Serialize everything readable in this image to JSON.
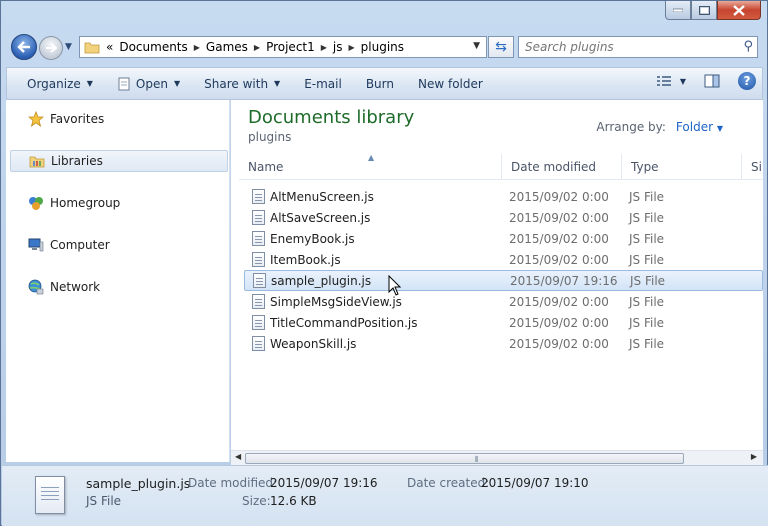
{
  "address": {
    "overflow_marker": "«",
    "crumbs": [
      "Documents",
      "Games",
      "Project1",
      "js",
      "plugins"
    ]
  },
  "search": {
    "placeholder": "Search plugins"
  },
  "toolbar": {
    "organize": "Organize",
    "open": "Open",
    "share_with": "Share with",
    "email": "E-mail",
    "burn": "Burn",
    "new_folder": "New folder"
  },
  "sidebar": {
    "items": [
      {
        "label": "Favorites",
        "icon": "star-icon"
      },
      {
        "label": "Libraries",
        "icon": "library-icon"
      },
      {
        "label": "Homegroup",
        "icon": "homegroup-icon"
      },
      {
        "label": "Computer",
        "icon": "computer-icon"
      },
      {
        "label": "Network",
        "icon": "network-icon"
      }
    ]
  },
  "main": {
    "library_title": "Documents library",
    "library_subtitle": "plugins",
    "arrange_label": "Arrange by:",
    "arrange_value": "Folder",
    "columns": {
      "name": "Name",
      "date": "Date modified",
      "type": "Type",
      "size": "Si"
    },
    "files": [
      {
        "name": "AltMenuScreen.js",
        "date": "2015/09/02 0:00",
        "type": "JS File"
      },
      {
        "name": "AltSaveScreen.js",
        "date": "2015/09/02 0:00",
        "type": "JS File"
      },
      {
        "name": "EnemyBook.js",
        "date": "2015/09/02 0:00",
        "type": "JS File"
      },
      {
        "name": "ItemBook.js",
        "date": "2015/09/02 0:00",
        "type": "JS File"
      },
      {
        "name": "sample_plugin.js",
        "date": "2015/09/07 19:16",
        "type": "JS File"
      },
      {
        "name": "SimpleMsgSideView.js",
        "date": "2015/09/02 0:00",
        "type": "JS File"
      },
      {
        "name": "TitleCommandPosition.js",
        "date": "2015/09/02 0:00",
        "type": "JS File"
      },
      {
        "name": "WeaponSkill.js",
        "date": "2015/09/02 0:00",
        "type": "JS File"
      }
    ],
    "selected_index": 4
  },
  "details": {
    "name": "sample_plugin.js",
    "type": "JS File",
    "date_modified_label": "Date modified:",
    "date_modified": "2015/09/07 19:16",
    "size_label": "Size:",
    "size": "12.6 KB",
    "date_created_label": "Date created:",
    "date_created": "2015/09/07 19:10"
  },
  "colors": {
    "accent": "#1e6b2a",
    "link": "#1e64c8",
    "selection": "#d3e4f7"
  }
}
